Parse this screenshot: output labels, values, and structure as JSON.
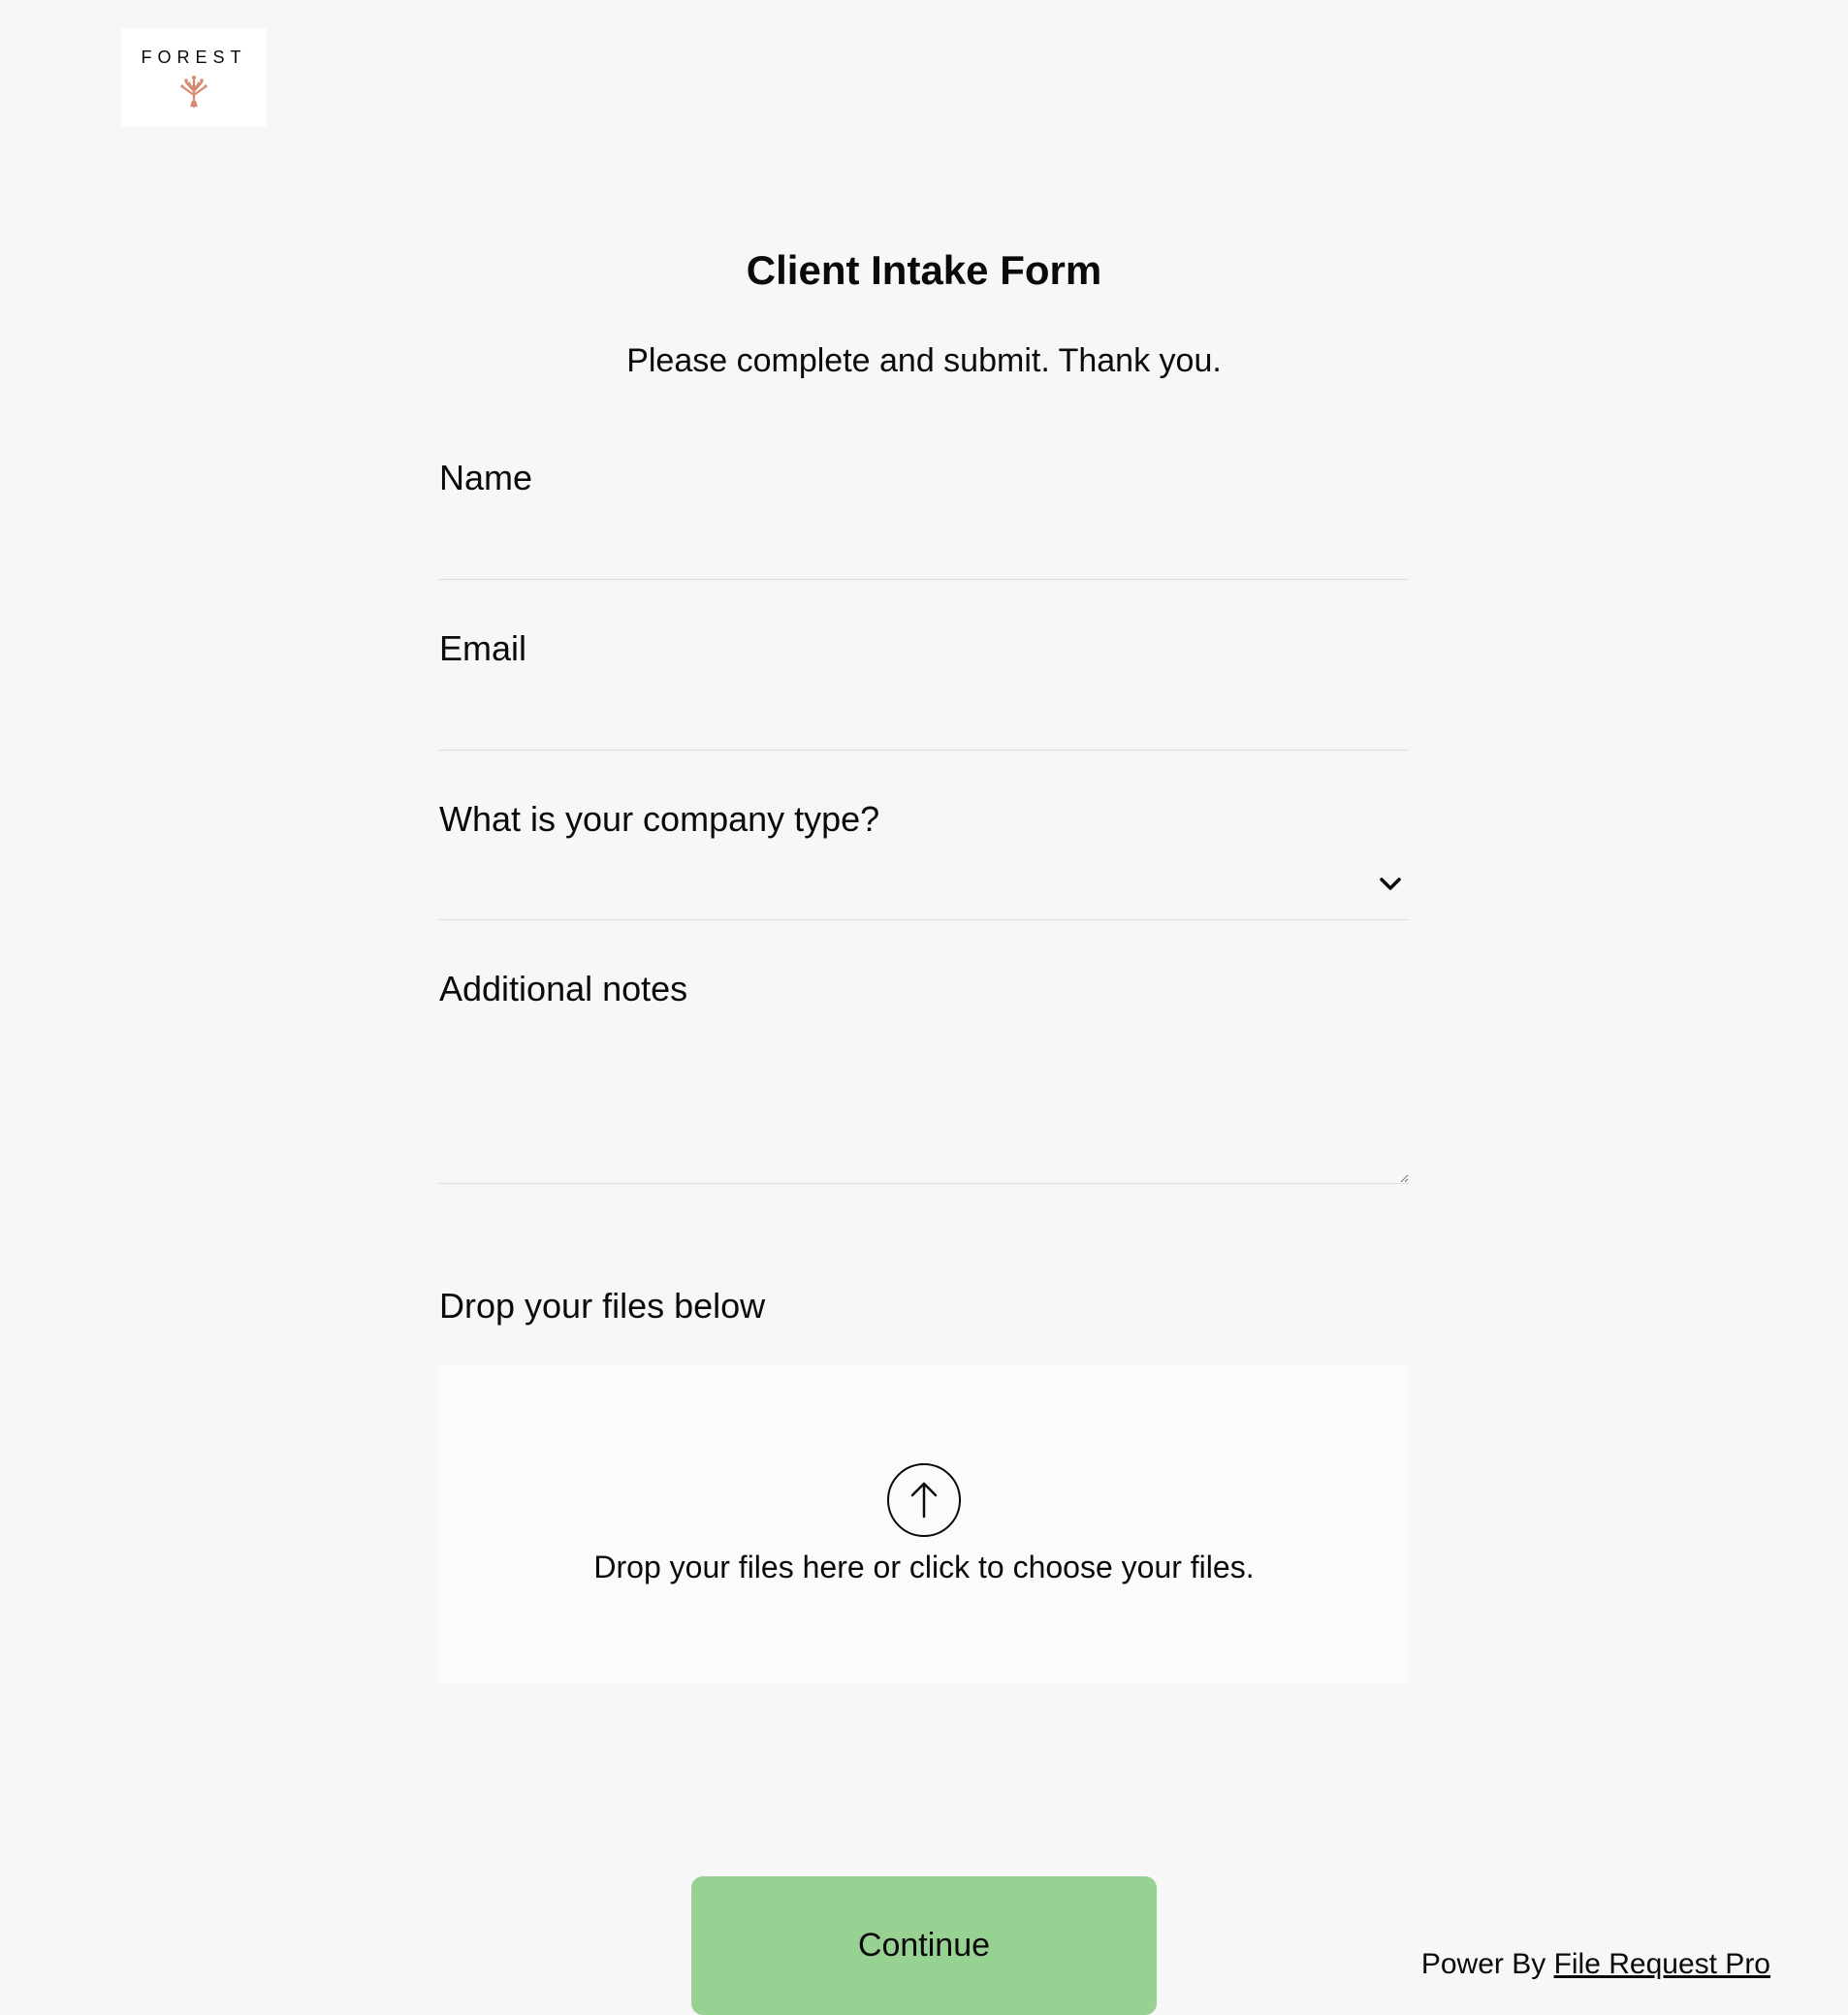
{
  "logo": {
    "text": "FOREST"
  },
  "form": {
    "title": "Client Intake Form",
    "subtitle": "Please complete and submit. Thank you.",
    "fields": {
      "name": {
        "label": "Name",
        "value": ""
      },
      "email": {
        "label": "Email",
        "value": ""
      },
      "company_type": {
        "label": "What is your company type?",
        "value": ""
      },
      "notes": {
        "label": "Additional notes",
        "value": ""
      }
    },
    "upload": {
      "label": "Drop your files below",
      "dropzone_text": "Drop your files here or click to choose your files."
    },
    "submit_label": "Continue"
  },
  "footer": {
    "prefix": "Power By ",
    "link_text": "File Request Pro"
  }
}
